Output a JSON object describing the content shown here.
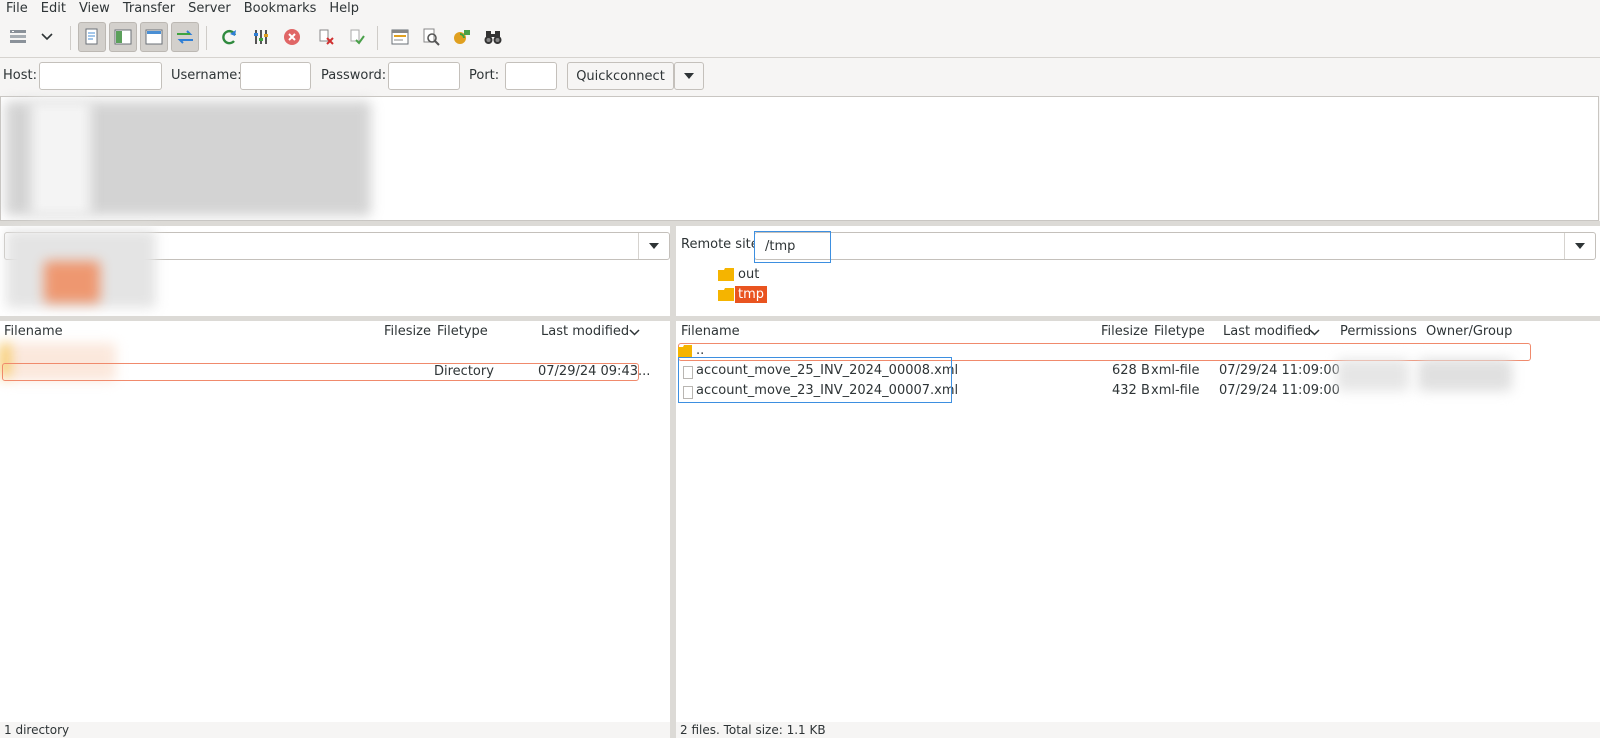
{
  "menu": [
    "File",
    "Edit",
    "View",
    "Transfer",
    "Server",
    "Bookmarks",
    "Help"
  ],
  "toolbar_icons": [
    "site-manager-icon",
    "dropdown-arrow-icon",
    "message-log-icon",
    "local-tree-icon",
    "remote-tree-icon",
    "transfer-queue-icon",
    "refresh-icon",
    "filter-icon",
    "cancel-icon",
    "disconnect-icon",
    "reconnect-icon",
    "directory-listing-icon",
    "search-files-icon",
    "compare-icon",
    "binoculars-icon"
  ],
  "quickconnect": {
    "host_label": "Host:",
    "username_label": "Username:",
    "password_label": "Password:",
    "port_label": "Port:",
    "button_label": "Quickconnect"
  },
  "local": {
    "columns": [
      "Filename",
      "Filesize",
      "Filetype",
      "Last modified"
    ],
    "rows": [
      {
        "filename": "",
        "filesize": "",
        "filetype": "Directory",
        "modified": "07/29/24 09:43..."
      }
    ],
    "status": "1 directory"
  },
  "remote": {
    "site_label": "Remote site:",
    "path": "/tmp",
    "tree": [
      "out",
      "tmp"
    ],
    "columns": [
      "Filename",
      "Filesize",
      "Filetype",
      "Last modified",
      "Permissions",
      "Owner/Group"
    ],
    "parent": "..",
    "rows": [
      {
        "filename": "account_move_25_INV_2024_00008.xml",
        "filesize": "628 B",
        "filetype": "xml-file",
        "modified": "07/29/24 11:09:00"
      },
      {
        "filename": "account_move_23_INV_2024_00007.xml",
        "filesize": "432 B",
        "filetype": "xml-file",
        "modified": "07/29/24 11:09:00"
      }
    ],
    "status": "2 files. Total size: 1.1 KB"
  },
  "colors": {
    "accent_orange": "#e95420",
    "folder_yellow": "#f5b400",
    "highlight_blue": "#3d8fe0"
  }
}
